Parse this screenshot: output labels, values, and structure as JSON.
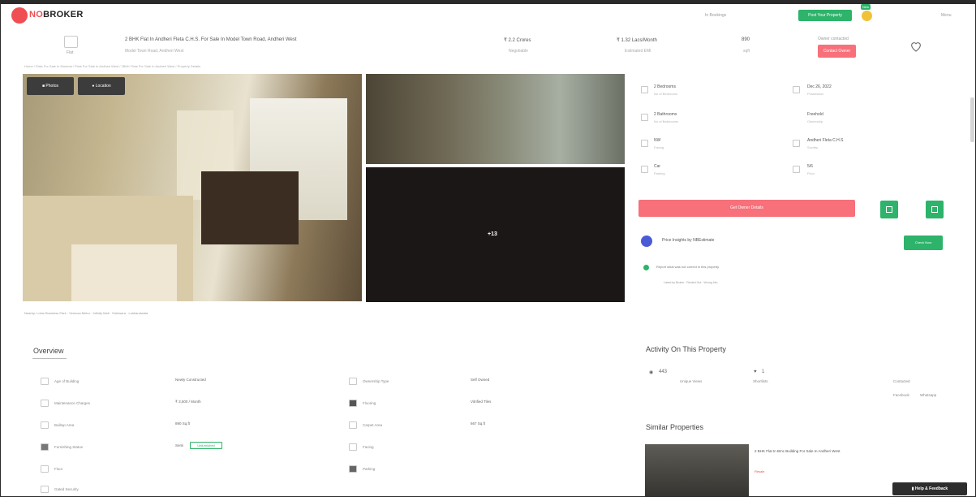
{
  "header": {
    "logo_prefix": "NO",
    "logo_suffix": "BROKER",
    "nav_link": "In Bookings",
    "post_button": "Post Your Property",
    "new_badge": "New",
    "menu_label": "Menu"
  },
  "property": {
    "title": "2 BHK Flat In Andheri Fleta C.H.S. For Sale In Model Town Road, Andheri West",
    "subtitle": "Model Town Road, Andheri West",
    "price": "₹ 2.2 Crores",
    "price_sub": "Negotiable",
    "emi": "₹ 1.32 Lacs/Month",
    "emi_sub": "Estimated EMI",
    "area": "890",
    "area_sub": "sqft",
    "owner_label": "Owner contacted",
    "contact_button": "Contact Owner",
    "home_label": "Flat",
    "breadcrumbs": "Home / Flats For Sale In Mumbai / Flats For Sale In Andheri West / 2BHK Flats For Sale In Andheri West / Property Details"
  },
  "gallery": {
    "photos_button": "Photos",
    "location_button": "Location",
    "more_count": "+13",
    "nearby": "Nearby: Lotus Business Park  ·  Versova Metro  ·  Infinity Mall  ·  Oshiwara  ·  Lokhandwala"
  },
  "details": {
    "bedrooms": "2 Bedrooms",
    "bedrooms_sub": "No of Bedrooms",
    "bathrooms": "2 Bathrooms",
    "bathrooms_sub": "No of Bathrooms",
    "facing": "NW",
    "facing_sub": "Facing",
    "parking": "Car",
    "parking_sub": "Parking",
    "possession": "Dec 26, 2022",
    "possession_sub": "Possession",
    "ownership": "Freehold",
    "ownership_sub": "Ownership",
    "society": "Andheri Fleta C.H.S",
    "society_sub": "Society",
    "floor": "5/6",
    "floor_sub": "Floor",
    "cta": "Get Owner Details",
    "nb_estimate": "Price Insights by NBEstimate",
    "check_button": "Check Now",
    "report_text": "Report what was not correct in this property",
    "report_opts": "Listed by Broker   ·   Rented Out   ·   Wrong Info"
  },
  "overview": {
    "title": "Overview",
    "rows": [
      {
        "label": "Age of Building",
        "value": "Newly Constructed"
      },
      {
        "label": "Ownership Type",
        "value": "Self Owned"
      },
      {
        "label": "Maintenance Charges",
        "value": "₹ 3,500 / Month"
      },
      {
        "label": "Flooring",
        "value": "Vitrified Tiles"
      },
      {
        "label": "Builtup Area",
        "value": "890 Sq.ft"
      },
      {
        "label": "Carpet Area",
        "value": "667 Sq.ft"
      },
      {
        "label": "Furnishing Status",
        "value": "Semi"
      },
      {
        "label": "Facing",
        "value": ""
      },
      {
        "label": "Floor",
        "value": ""
      },
      {
        "label": "Parking",
        "value": ""
      },
      {
        "label": "Gated Security",
        "value": ""
      }
    ],
    "furnish_tag": "Unfurnished"
  },
  "activity": {
    "title": "Activity On This Property",
    "views": "443",
    "views_sub": "Unique Views",
    "shortlists": "1",
    "shortlists_sub": "Shortlists",
    "contacted": "Contacted",
    "tab1": "Facebook",
    "tab2": "Whatsapp"
  },
  "similar": {
    "title": "Similar Properties",
    "item_title": "2 BHK Flat In Bmc Building For Sale In Andheri West",
    "item_tag": "Resale"
  },
  "help_button": "Help & Feedback",
  "colors": {
    "brand_red": "#ef4f52",
    "cta_pink": "#f7707a",
    "green": "#2db36a"
  }
}
